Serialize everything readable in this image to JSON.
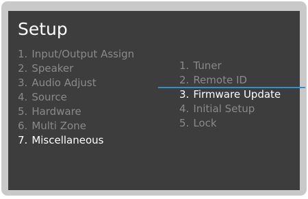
{
  "title": "Setup",
  "main_menu": [
    {
      "num": "1.",
      "label": "Input/Output Assign"
    },
    {
      "num": "2.",
      "label": "Speaker"
    },
    {
      "num": "3.",
      "label": "Audio Adjust"
    },
    {
      "num": "4.",
      "label": "Source"
    },
    {
      "num": "5.",
      "label": "Hardware"
    },
    {
      "num": "6.",
      "label": "Multi Zone"
    },
    {
      "num": "7.",
      "label": "Miscellaneous"
    }
  ],
  "main_menu_selected": "7. Miscellaneous",
  "sub_menu": [
    {
      "num": "1.",
      "label": "Tuner"
    },
    {
      "num": "2.",
      "label": "Remote ID"
    },
    {
      "num": "3.",
      "label": "Firmware Update"
    },
    {
      "num": "4.",
      "label": "Initial Setup"
    },
    {
      "num": "5.",
      "label": "Lock"
    }
  ],
  "sub_menu_selected": "3. Firmware Update",
  "colors": {
    "frame": "#c9c9c9",
    "screen_background": "#3d3d3d",
    "active_text": "#ffffff",
    "inactive_text": "#8a8a8a",
    "cursor_line": "#2e92c8"
  }
}
